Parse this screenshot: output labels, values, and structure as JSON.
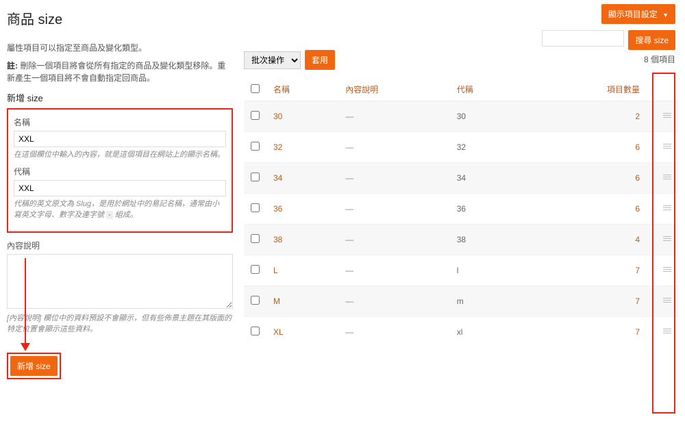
{
  "header": {
    "display_settings": "顯示項目設定",
    "title": "商品 size",
    "search_placeholder": "",
    "search_button": "搜尋 size",
    "item_count_text": "8 個項目"
  },
  "left": {
    "intro": "屬性項目可以指定至商品及變化類型。",
    "note_label": "註:",
    "note_text": "刪除一個項目將會從所有指定的商品及變化類型移除。重新產生一個項目將不會自動指定回商品。",
    "add_title": "新增 size",
    "name_label": "名稱",
    "name_value": "XXL",
    "name_help": "在這個欄位中輸入的內容，就是這個項目在網站上的顯示名稱。",
    "slug_label": "代稱",
    "slug_value": "XXL",
    "slug_help_1": "代稱的",
    "slug_help_em": "英文原文為 Slug",
    "slug_help_2": "，是用於網址中的易記名稱，通常由小寫英文字母、數字及連字號",
    "slug_help_dash": "-",
    "slug_help_3": "組成。",
    "desc_label": "內容說明",
    "desc_value": "",
    "desc_help": "[內容說明] 欄位中的資料預設不會顯示，但有些佈景主題在其版面的特定位置會顯示這些資料。",
    "submit": "新增 size"
  },
  "bulk": {
    "label": "批次操作",
    "apply": "套用"
  },
  "table": {
    "cols": {
      "name": "名稱",
      "desc": "內容說明",
      "slug": "代稱",
      "count": "項目數量"
    },
    "rows": [
      {
        "name": "30",
        "desc": "—",
        "slug": "30",
        "count": "2"
      },
      {
        "name": "32",
        "desc": "—",
        "slug": "32",
        "count": "6"
      },
      {
        "name": "34",
        "desc": "—",
        "slug": "34",
        "count": "6"
      },
      {
        "name": "36",
        "desc": "—",
        "slug": "36",
        "count": "6"
      },
      {
        "name": "38",
        "desc": "—",
        "slug": "38",
        "count": "4"
      },
      {
        "name": "L",
        "desc": "—",
        "slug": "l",
        "count": "7"
      },
      {
        "name": "M",
        "desc": "—",
        "slug": "m",
        "count": "7"
      },
      {
        "name": "XL",
        "desc": "—",
        "slug": "xl",
        "count": "7"
      }
    ]
  }
}
